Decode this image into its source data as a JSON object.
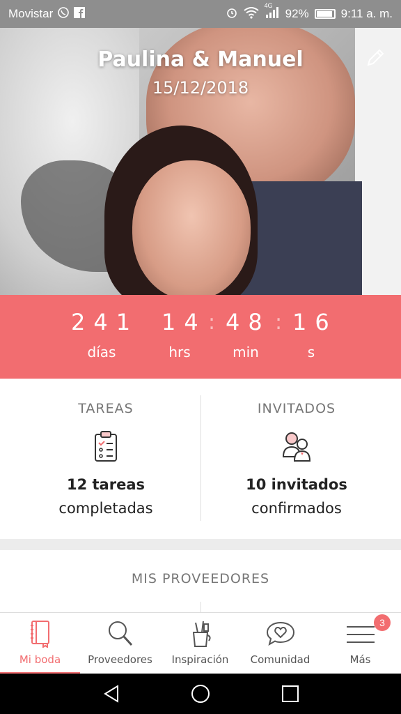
{
  "status_bar": {
    "carrier": "Movistar",
    "network": "4G",
    "battery": "92%",
    "battery_level": 0.92,
    "time": "9:11 a. m."
  },
  "hero": {
    "couple": "Paulina & Manuel",
    "date": "15/12/2018"
  },
  "countdown": {
    "days": "241",
    "hours": "14",
    "minutes": "48",
    "seconds": "16",
    "labels": {
      "days": "días",
      "hours": "hrs",
      "minutes": "min",
      "seconds": "s"
    },
    "separator": ":"
  },
  "tasks": {
    "header": "TAREAS",
    "count": "12 tareas",
    "subtitle": "completadas"
  },
  "guests": {
    "header": "INVITADOS",
    "count": "10 invitados",
    "subtitle": "confirmados"
  },
  "providers": {
    "header": "MIS PROVEEDORES"
  },
  "bottom_nav": {
    "items": [
      {
        "label": "Mi boda",
        "icon": "notebook-icon",
        "active": true
      },
      {
        "label": "Proveedores",
        "icon": "search-icon"
      },
      {
        "label": "Inspiración",
        "icon": "pencil-cup-icon"
      },
      {
        "label": "Comunidad",
        "icon": "chat-heart-icon"
      },
      {
        "label": "Más",
        "icon": "menu-icon"
      }
    ],
    "more_badge": "3"
  },
  "colors": {
    "accent": "#f26d70",
    "status_bar": "#8e8e8e"
  }
}
